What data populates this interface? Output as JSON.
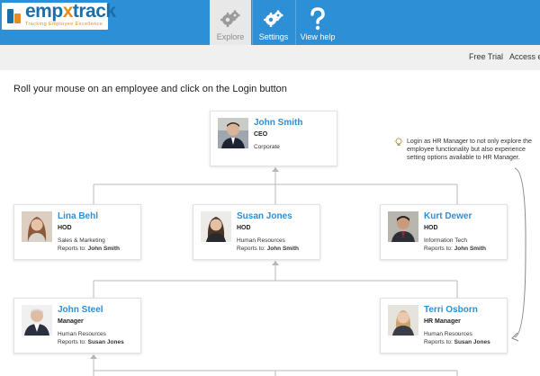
{
  "header": {
    "logo": {
      "name": "empxtrack",
      "tagline": "Tracking Employee Excellence"
    },
    "nav": [
      {
        "label": "Explore",
        "icon": "gears-icon",
        "active": true
      },
      {
        "label": "Settings",
        "icon": "gears-icon",
        "active": false
      },
      {
        "label": "View help",
        "icon": "question-mark-icon",
        "active": false
      }
    ],
    "accent_color": "#2d8fd5"
  },
  "subbar": {
    "links": [
      "Free Trial",
      "Access e"
    ]
  },
  "instruction": "Roll your mouse on an employee and click on the Login button",
  "tip": {
    "icon": "lightbulb-icon",
    "text": "Login as HR Manager to not only explore the employee functionality but also experience setting options available to HR Manager."
  },
  "reports_label": "Reports to:",
  "employees": [
    {
      "id": "ceo",
      "name": "John Smith",
      "role": "CEO",
      "department": "Corporate",
      "reports_to": ""
    },
    {
      "id": "lina",
      "name": "Lina Behl",
      "role": "HOD",
      "department": "Sales & Marketing",
      "reports_to": "John Smith"
    },
    {
      "id": "susan",
      "name": "Susan Jones",
      "role": "HOD",
      "department": "Human Resources",
      "reports_to": "John Smith"
    },
    {
      "id": "kurt",
      "name": "Kurt Dewer",
      "role": "HOD",
      "department": "Information Tech",
      "reports_to": "John Smith"
    },
    {
      "id": "steel",
      "name": "John Steel",
      "role": "Manager",
      "department": "Human Resources",
      "reports_to": "Susan Jones"
    },
    {
      "id": "terri",
      "name": "Terri Osborn",
      "role": "HR Manager",
      "department": "Human Resources",
      "reports_to": "Susan Jones"
    }
  ]
}
